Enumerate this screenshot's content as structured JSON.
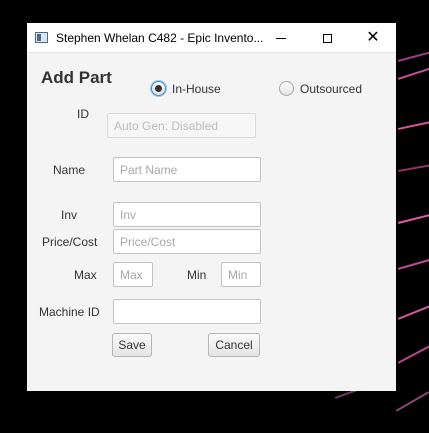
{
  "window": {
    "title": "Stephen Whelan C482 - Epic Invento...",
    "close_glyph": "✕"
  },
  "form": {
    "heading": "Add Part",
    "source": {
      "options": [
        "In-House",
        "Outsourced"
      ],
      "selected": "In-House"
    },
    "id": {
      "label": "ID",
      "placeholder": "Auto Gen: Disabled",
      "disabled": true
    },
    "name": {
      "label": "Name",
      "placeholder": "Part Name",
      "value": ""
    },
    "inv": {
      "label": "Inv",
      "placeholder": "Inv",
      "value": ""
    },
    "price": {
      "label": "Price/Cost",
      "placeholder": "Price/Cost",
      "value": ""
    },
    "max": {
      "label": "Max",
      "placeholder": "Max",
      "value": ""
    },
    "min": {
      "label": "Min",
      "placeholder": "Min",
      "value": ""
    },
    "machine_id": {
      "label": "Machine ID",
      "placeholder": "",
      "value": ""
    },
    "buttons": {
      "save": "Save",
      "cancel": "Cancel"
    }
  }
}
